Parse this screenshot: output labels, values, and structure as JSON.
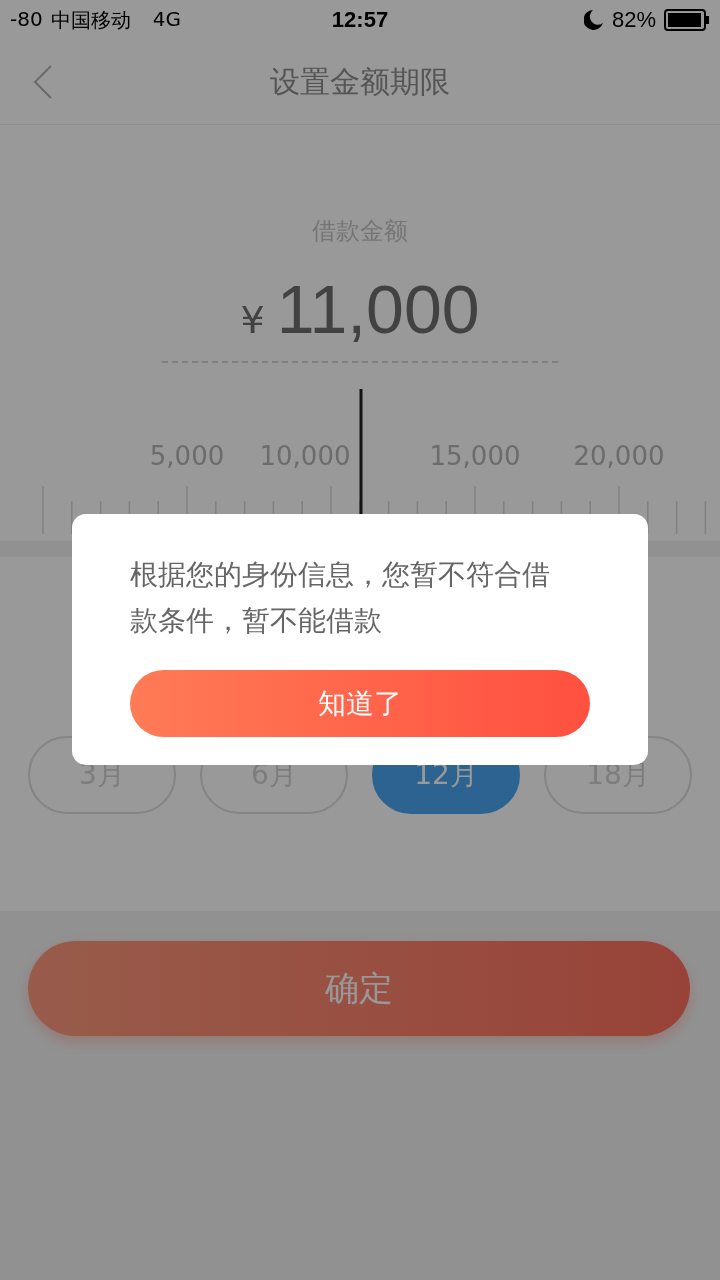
{
  "status_bar": {
    "signal": "-80",
    "carrier": "中国移动",
    "network": "4G",
    "time": "12:57",
    "battery": "82%"
  },
  "nav": {
    "title": "设置金额期限"
  },
  "amount": {
    "label": "借款金额",
    "currency": "¥",
    "value": "11,000"
  },
  "ruler": {
    "labels": [
      "5,000",
      "10,000",
      "15,000",
      "20,000"
    ]
  },
  "periods": [
    {
      "label": "3月",
      "selected": false
    },
    {
      "label": "6月",
      "selected": false
    },
    {
      "label": "12月",
      "selected": true
    },
    {
      "label": "18月",
      "selected": false
    }
  ],
  "confirm_button": "确定",
  "dialog": {
    "message": "根据您的身份信息，您暂不符合借款条件，暂不能借款",
    "button": "知道了"
  }
}
